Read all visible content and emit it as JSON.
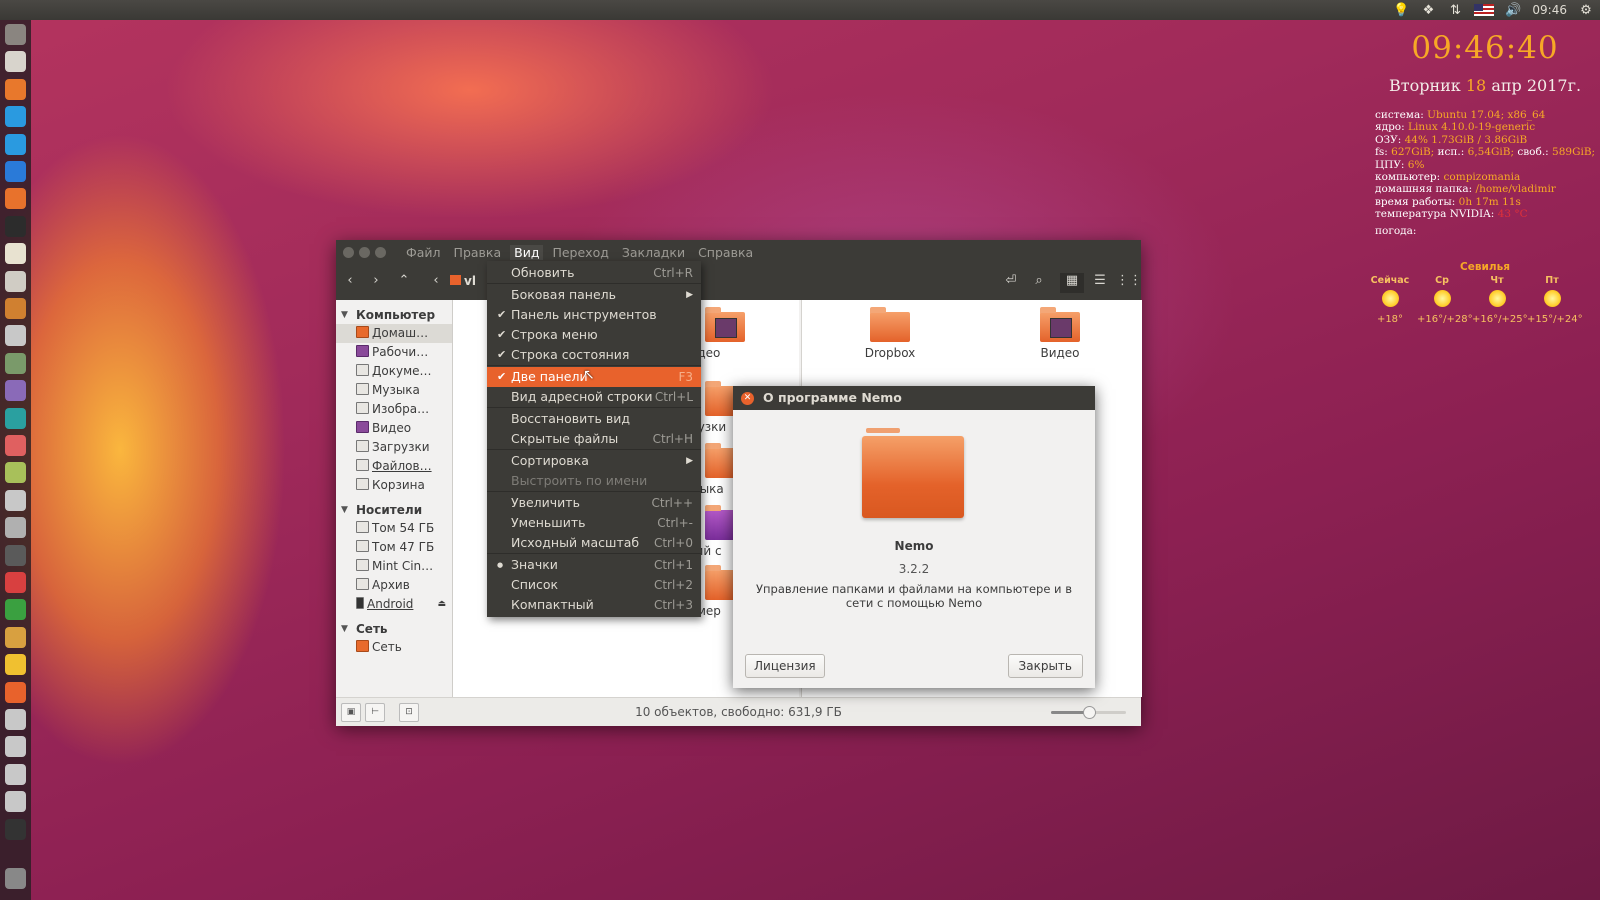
{
  "top_panel": {
    "time": "09:46",
    "icons": [
      "lightbulb-icon",
      "dropbox-icon",
      "network-arrows-icon",
      "us-flag-icon",
      "volume-icon",
      "gear-icon"
    ]
  },
  "launcher": {
    "icons": [
      "power-icon",
      "files-icon",
      "firefox-icon",
      "skype-icon",
      "skype-alt-icon",
      "dropbox-icon",
      "software-center-icon",
      "terminal-icon",
      "text-editor-icon",
      "screenshot-icon",
      "system-icon",
      "settings-icon",
      "photos-icon",
      "back-icon",
      "sync-icon",
      "media-icon",
      "archive-icon",
      "recorder-icon",
      "monitor-icon",
      "video-icon",
      "calendar-icon",
      "browser-icon",
      "store-icon",
      "emoji-icon",
      "folder-icon",
      "drive-icon",
      "drive-icon",
      "drive-icon",
      "drive-icon",
      "phone-icon",
      "trash-icon"
    ]
  },
  "conky": {
    "clock": "09:46:40",
    "date_pre": "Вторник",
    "date_day": "18",
    "date_post": "апр 2017г.",
    "system": [
      {
        "k": "система:",
        "v": "Ubuntu 17.04; x86_64"
      },
      {
        "k": "ядро:",
        "v": "Linux 4.10.0-19-generic"
      },
      {
        "k": "ОЗУ:",
        "v": "44% 1.73GiB / 3.86GiB"
      }
    ],
    "fs": {
      "k": "fs:",
      "v1": "627GiB;",
      "k2": "исп.:",
      "v2": "6,54GiB;",
      "k3": "своб.:",
      "v3": "589GiB;"
    },
    "system2": [
      {
        "k": "ЦПУ:",
        "v": "6%"
      },
      {
        "k": "компьютер:",
        "v": "compizomania"
      },
      {
        "k": "домашняя папка:",
        "v": "/home/vladimir"
      },
      {
        "k": "время работы:",
        "v": "0h 17m 11s"
      }
    ],
    "nvidia": {
      "k": "температура NVIDIA:",
      "v": "43 °C"
    },
    "weather_label": "погода:",
    "weather": {
      "city": "Севилья",
      "days": [
        {
          "day": "Сейчас",
          "temp": "+18°"
        },
        {
          "day": "Ср",
          "temp": "+16°/+28°"
        },
        {
          "day": "Чт",
          "temp": "+16°/+25°"
        },
        {
          "day": "Пт",
          "temp": "+15°/+24°"
        }
      ]
    }
  },
  "nemo": {
    "menu": [
      "Файл",
      "Правка",
      "Вид",
      "Переход",
      "Закладки",
      "Справка"
    ],
    "path_label": "vl",
    "sidebar": {
      "computer": {
        "title": "Компьютер",
        "items": [
          "Домаш…",
          "Рабочи…",
          "Докуме…",
          "Музыка",
          "Изобра…",
          "Видео",
          "Загрузки",
          "Файлов…",
          "Корзина"
        ]
      },
      "devices": {
        "title": "Носители",
        "items": [
          "Том 54 ГБ",
          "Том 47 ГБ",
          "Mint Cin…",
          "Архив",
          "Android"
        ]
      },
      "network": {
        "title": "Сеть",
        "items": [
          "Сеть"
        ]
      }
    },
    "left_pane": [
      "идео",
      "грузки",
      "узыка",
      "чий с",
      "имер"
    ],
    "right_pane": [
      "Dropbox",
      "Видео"
    ],
    "status": "10 объектов, свободно: 631,9 ГБ",
    "zoom_level": 0.5
  },
  "view_menu": [
    {
      "label": "Обновить",
      "shortcut": "Ctrl+R"
    },
    {
      "label": "Боковая панель",
      "submenu": true
    },
    {
      "label": "Панель инструментов",
      "checked": true
    },
    {
      "label": "Строка меню",
      "checked": true
    },
    {
      "label": "Строка состояния",
      "checked": true
    },
    {
      "label": "Две панели",
      "shortcut": "F3",
      "checked": true,
      "highlighted": true
    },
    {
      "label": "Вид адресной строки",
      "shortcut": "Ctrl+L"
    },
    {
      "label": "Восстановить вид"
    },
    {
      "label": "Скрытые файлы",
      "shortcut": "Ctrl+H"
    },
    {
      "label": "Сортировка",
      "submenu": true
    },
    {
      "label": "Выстроить по имени",
      "disabled": true
    },
    {
      "label": "Увеличить",
      "shortcut": "Ctrl++"
    },
    {
      "label": "Уменьшить",
      "shortcut": "Ctrl+-"
    },
    {
      "label": "Исходный масштаб",
      "shortcut": "Ctrl+0"
    },
    {
      "label": "Значки",
      "shortcut": "Ctrl+1",
      "radio": true
    },
    {
      "label": "Список",
      "shortcut": "Ctrl+2"
    },
    {
      "label": "Компактный",
      "shortcut": "Ctrl+3"
    }
  ],
  "about": {
    "title": "О программе Nemo",
    "name": "Nemo",
    "version": "3.2.2",
    "description": "Управление папками и файлами на компьютере и в сети с помощью Nemo",
    "license_button": "Лицензия",
    "close_button": "Закрыть"
  }
}
